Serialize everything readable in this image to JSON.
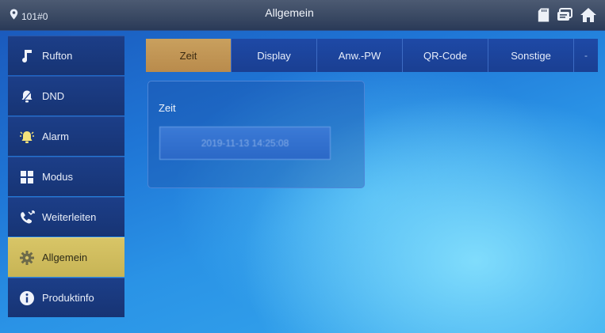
{
  "header": {
    "room": "101#0",
    "title": "Allgemein"
  },
  "sidebar": {
    "items": [
      {
        "label": "Rufton",
        "icon": "music-note-icon",
        "active": false
      },
      {
        "label": "DND",
        "icon": "bell-off-icon",
        "active": false
      },
      {
        "label": "Alarm",
        "icon": "alarm-bell-icon",
        "active": false
      },
      {
        "label": "Modus",
        "icon": "grid-icon",
        "active": false
      },
      {
        "label": "Weiterleiten",
        "icon": "call-forward-icon",
        "active": false
      },
      {
        "label": "Allgemein",
        "icon": "gear-icon",
        "active": true
      },
      {
        "label": "Produktinfo",
        "icon": "info-icon",
        "active": false
      }
    ]
  },
  "tabs": [
    {
      "label": "Zeit",
      "active": true
    },
    {
      "label": "Display",
      "active": false
    },
    {
      "label": "Anw.-PW",
      "active": false
    },
    {
      "label": "QR-Code",
      "active": false
    },
    {
      "label": "Sonstige",
      "active": false
    }
  ],
  "tab_more": "-",
  "panel": {
    "field_label": "Zeit",
    "time_value": "2019-11-13 14:25:08"
  },
  "colors": {
    "active_sidebar": "#d8c567",
    "active_tab": "#c9a05e",
    "tab_bg": "#1e49a6"
  }
}
